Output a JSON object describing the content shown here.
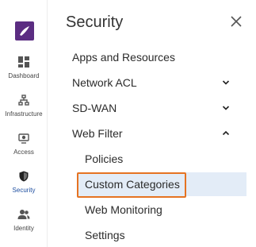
{
  "rail": {
    "items": [
      {
        "label": "Dashboard",
        "icon": "dashboard-icon"
      },
      {
        "label": "Infrastructure",
        "icon": "infrastructure-icon"
      },
      {
        "label": "Access",
        "icon": "access-icon"
      },
      {
        "label": "Security",
        "icon": "shield-icon",
        "active": true
      },
      {
        "label": "Identity",
        "icon": "identity-icon"
      }
    ]
  },
  "panel": {
    "title": "Security",
    "menu": [
      {
        "label": "Apps and Resources",
        "expandable": false
      },
      {
        "label": "Network ACL",
        "expandable": true,
        "expanded": false
      },
      {
        "label": "SD-WAN",
        "expandable": true,
        "expanded": false
      },
      {
        "label": "Web Filter",
        "expandable": true,
        "expanded": true,
        "children": [
          {
            "label": "Policies"
          },
          {
            "label": "Custom Categories",
            "selected": true
          },
          {
            "label": "Web Monitoring"
          },
          {
            "label": "Settings"
          }
        ]
      }
    ]
  },
  "colors": {
    "brand": "#5b2d82",
    "selected_bg": "#e3ecf7",
    "focus_outline": "#e57322",
    "active_rail_text": "#1f4fa0"
  }
}
